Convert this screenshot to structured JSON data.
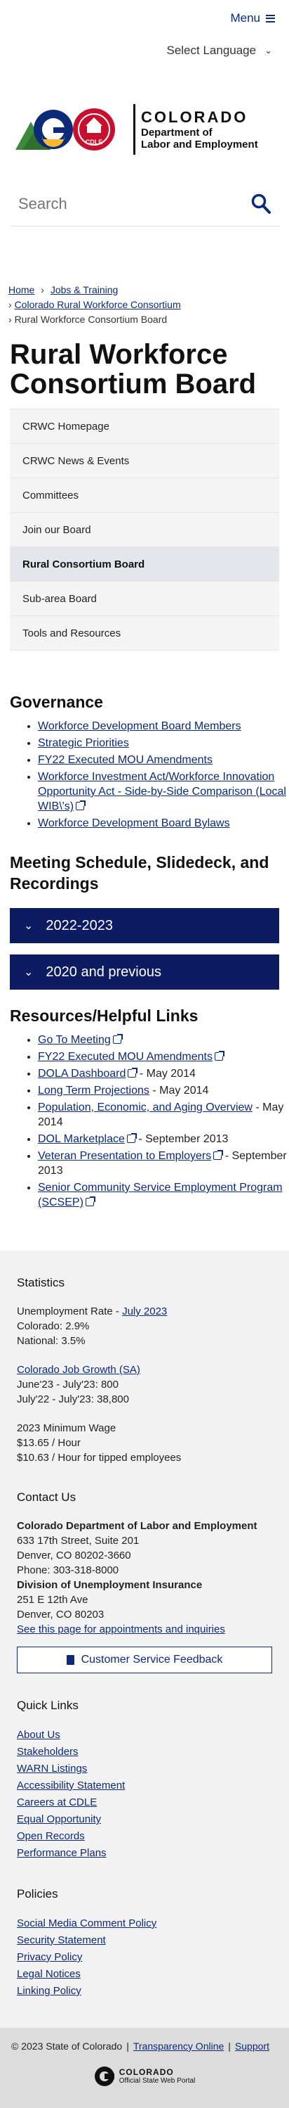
{
  "header": {
    "menu_label": "Menu",
    "language_label": "Select Language",
    "logo": {
      "state_name": "COLORADO",
      "dept_line1": "Department of",
      "dept_line2": "Labor and Employment",
      "badge": "CDLE"
    },
    "search_placeholder": "Search"
  },
  "breadcrumb": {
    "items": [
      "Home",
      "Jobs & Training",
      "Colorado Rural Workforce Consortium",
      "Rural Workforce Consortium Board"
    ]
  },
  "page_title": "Rural Workforce Consortium Board",
  "sidenav": [
    {
      "label": "CRWC Homepage"
    },
    {
      "label": "CRWC News & Events"
    },
    {
      "label": "Committees"
    },
    {
      "label": "Join our Board"
    },
    {
      "label": "Rural Consortium Board",
      "active": true
    },
    {
      "label": "Sub-area Board"
    },
    {
      "label": "Tools and Resources"
    }
  ],
  "governance": {
    "title": "Governance",
    "links": [
      {
        "text": "Workforce Development Board Members",
        "suffix": ""
      },
      {
        "text": "Strategic Priorities",
        "suffix": ""
      },
      {
        "text": "FY22 Executed MOU Amendments",
        "suffix": ""
      },
      {
        "text": "Workforce Investment Act/Workforce Innovation Opportunity Act - Side-by-Side Comparison (Local WIB\\'s)",
        "suffix": "",
        "external": true
      },
      {
        "text": "Workforce Development Board Bylaws",
        "suffix": ""
      }
    ]
  },
  "meetings": {
    "title": "Meeting Schedule, Slidedeck, and Recordings",
    "accordions": [
      "2022-2023",
      "2020 and previous"
    ]
  },
  "resources": {
    "title": "Resources/Helpful Links",
    "links": [
      {
        "text": "Go To Meeting",
        "suffix": "",
        "external": true
      },
      {
        "text": "FY22 Executed MOU Amendments",
        "suffix": "",
        "external": true
      },
      {
        "text": "DOLA Dashboard",
        "suffix": " - May 2014",
        "external": true
      },
      {
        "text": "Long Term Projections",
        "suffix": " - May 2014"
      },
      {
        "text": "Population, Economic, and Aging Overview",
        "suffix": " - May 2014"
      },
      {
        "text": "DOL Marketplace",
        "suffix": " - September 2013",
        "external": true
      },
      {
        "text": "Veteran Presentation to Employers",
        "suffix": " - September 2013",
        "external": true
      },
      {
        "text": "Senior Community Service Employment Program (SCSEP)",
        "suffix": "",
        "external": true
      }
    ]
  },
  "footer": {
    "statistics": {
      "title": "Statistics",
      "unemployment_label": "Unemployment Rate - ",
      "unemployment_link": "July 2023",
      "colorado": "Colorado: 2.9%",
      "national": "National: 3.5%",
      "growth_link": "Colorado Job Growth (SA)",
      "growth_1": "June'23 - July'23: 800",
      "growth_2": "July'22 - July'23: 38,800",
      "wage_title": "2023 Minimum Wage",
      "wage_1": "$13.65 / Hour",
      "wage_2": "$10.63 / Hour for tipped employees"
    },
    "contact": {
      "title": "Contact Us",
      "org1": "Colorado Department of Labor and Employment",
      "addr1": "633 17th Street, Suite 201",
      "city1": "Denver, CO  80202-3660",
      "phone1": "Phone: 303-318-8000",
      "org2": "Division of Unemployment Insurance",
      "addr2": "251 E 12th Ave",
      "city2": "Denver, CO  80203",
      "appointments_link": "See this page for appointments and inquiries",
      "feedback_button": "Customer Service Feedback"
    },
    "quick_links": {
      "title": "Quick Links",
      "items": [
        "About Us",
        "Stakeholders",
        "WARN Listings",
        "Accessibility Statement",
        "Careers at CDLE",
        "Equal Opportunity",
        "Open Records",
        "Performance Plans"
      ]
    },
    "policies": {
      "title": "Policies",
      "items": [
        "Social Media Comment Policy",
        "Security Statement",
        "Privacy Policy",
        "Legal Notices",
        "Linking Policy"
      ]
    },
    "bottom": {
      "copyright": "© 2023 State of Colorado",
      "transparency": "Transparency Online",
      "support": "Support",
      "portal_state": "COLORADO",
      "portal_sub": "Official State Web Portal"
    }
  },
  "colors": {
    "navy": "#0d1b63",
    "link": "#0c2a7a",
    "logo_red": "#c8102e",
    "logo_green": "#3a8a3a",
    "logo_gold": "#f5b82e"
  }
}
